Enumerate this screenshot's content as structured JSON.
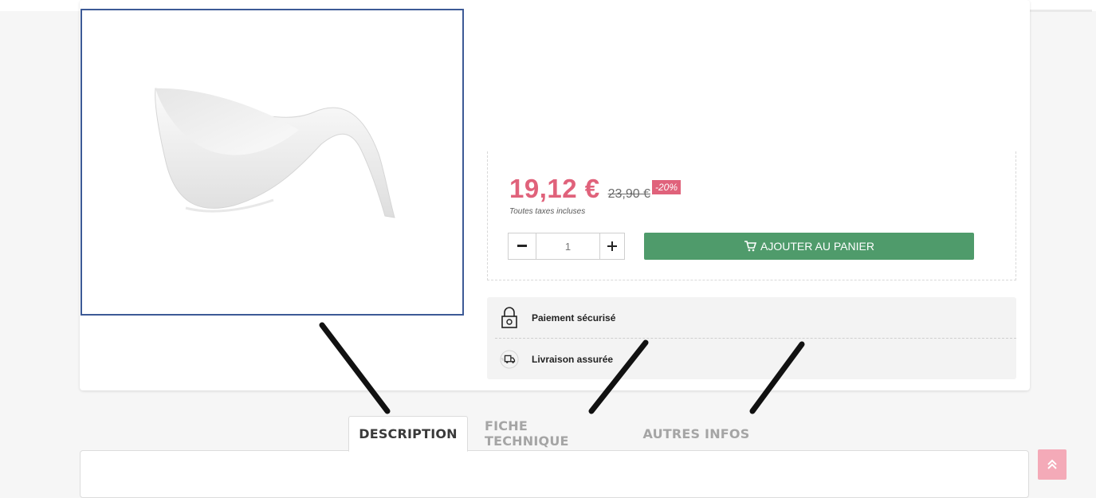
{
  "product": {
    "price_current": "19,12 €",
    "price_old": "23,90 €",
    "discount": "-20%",
    "tax_note": "Toutes taxes incluses",
    "quantity": "1",
    "add_to_cart_label": "AJOUTER AU PANIER",
    "image_icon": "white-porcelain-bowl-with-handle"
  },
  "reassurance": {
    "items": [
      {
        "icon": "lock-icon",
        "label": "Paiement sécurisé"
      },
      {
        "icon": "delivery-truck-icon",
        "label": "Livraison assurée"
      }
    ]
  },
  "tabs": [
    {
      "label": "DESCRIPTION",
      "active": true
    },
    {
      "label": "FICHE TECHNIQUE",
      "active": false
    },
    {
      "label": "AUTRES INFOS",
      "active": false
    }
  ],
  "colors": {
    "price": "#e0627b",
    "add_to_cart": "#4f9b6b",
    "image_frame": "#3d5a96",
    "back_to_top": "#f4aab8"
  },
  "controls": {
    "qty_minus_icon": "minus-icon",
    "qty_plus_icon": "plus-icon",
    "cart_icon": "cart-icon",
    "back_to_top_icon": "chevrons-up-icon"
  }
}
